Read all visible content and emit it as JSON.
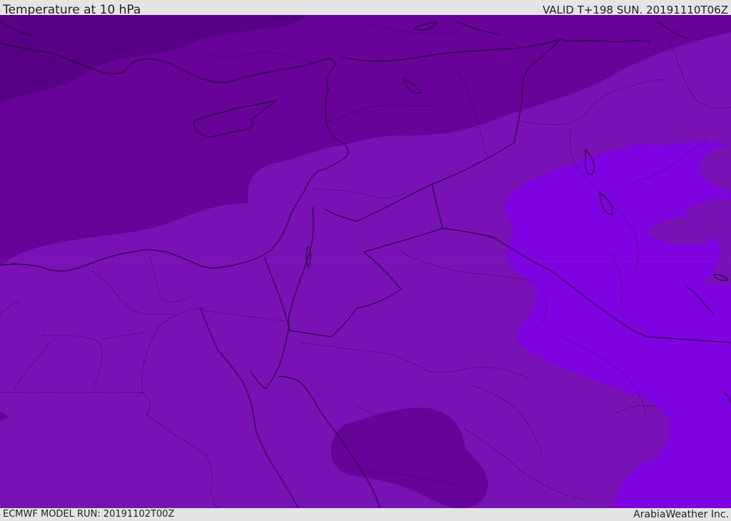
{
  "header": {
    "title": "Temperature at 10 hPa",
    "valid_time": "VALID T+198 SUN. 20191110T06Z"
  },
  "footer": {
    "model_run": "ECMWF MODEL RUN: 20191102T00Z",
    "credit": "ArabiaWeather Inc."
  },
  "map": {
    "colors": {
      "darkest": "#570085",
      "dark": "#670399",
      "mid": "#7812b5",
      "bright": "#7f02e0",
      "border": "#1a0030"
    }
  }
}
